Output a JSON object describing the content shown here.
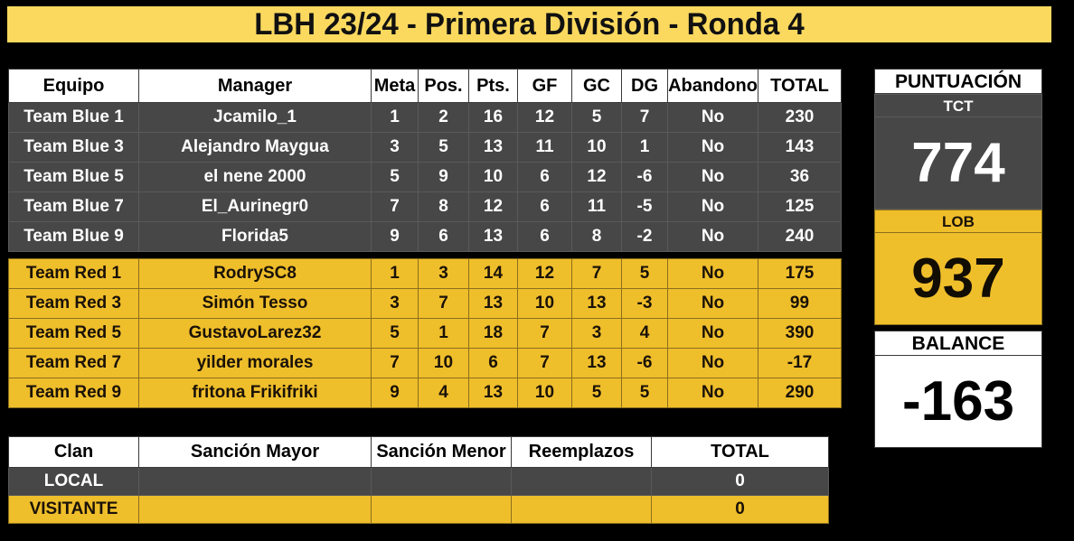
{
  "header": {
    "title": "LBH 23/24 - Primera División - Ronda 4",
    "banner_color": "#FBD95F"
  },
  "colors": {
    "yellow": "#EFBE2B",
    "dark_gray": "#474747",
    "white": "#FFFFFF",
    "black": "#000000"
  },
  "standings": {
    "columns": [
      "Equipo",
      "Manager",
      "Meta",
      "Pos.",
      "Pts.",
      "GF",
      "GC",
      "DG",
      "Abandono",
      "TOTAL"
    ],
    "blue_rows": [
      {
        "equipo": "Team Blue 1",
        "manager": "Jcamilo_1",
        "meta": "1",
        "pos": "2",
        "pts": "16",
        "gf": "12",
        "gc": "5",
        "dg": "7",
        "abandono": "No",
        "total": "230"
      },
      {
        "equipo": "Team Blue 3",
        "manager": "Alejandro Maygua",
        "meta": "3",
        "pos": "5",
        "pts": "13",
        "gf": "11",
        "gc": "10",
        "dg": "1",
        "abandono": "No",
        "total": "143"
      },
      {
        "equipo": "Team Blue 5",
        "manager": "el nene 2000",
        "meta": "5",
        "pos": "9",
        "pts": "10",
        "gf": "6",
        "gc": "12",
        "dg": "-6",
        "abandono": "No",
        "total": "36"
      },
      {
        "equipo": "Team Blue 7",
        "manager": "El_Aurinegr0",
        "meta": "7",
        "pos": "8",
        "pts": "12",
        "gf": "6",
        "gc": "11",
        "dg": "-5",
        "abandono": "No",
        "total": "125"
      },
      {
        "equipo": "Team Blue 9",
        "manager": "Florida5",
        "meta": "9",
        "pos": "6",
        "pts": "13",
        "gf": "6",
        "gc": "8",
        "dg": "-2",
        "abandono": "No",
        "total": "240"
      }
    ],
    "red_rows": [
      {
        "equipo": "Team Red 1",
        "manager": "RodrySC8",
        "meta": "1",
        "pos": "3",
        "pts": "14",
        "gf": "12",
        "gc": "7",
        "dg": "5",
        "abandono": "No",
        "total": "175"
      },
      {
        "equipo": "Team Red 3",
        "manager": "Simón Tesso",
        "meta": "3",
        "pos": "7",
        "pts": "13",
        "gf": "10",
        "gc": "13",
        "dg": "-3",
        "abandono": "No",
        "total": "99"
      },
      {
        "equipo": "Team Red 5",
        "manager": "GustavoLarez32",
        "meta": "5",
        "pos": "1",
        "pts": "18",
        "gf": "7",
        "gc": "3",
        "dg": "4",
        "abandono": "No",
        "total": "390"
      },
      {
        "equipo": "Team Red 7",
        "manager": "yilder morales",
        "meta": "7",
        "pos": "10",
        "pts": "6",
        "gf": "7",
        "gc": "13",
        "dg": "-6",
        "abandono": "No",
        "total": "-17"
      },
      {
        "equipo": "Team Red 9",
        "manager": "fritona Frikifriki",
        "meta": "9",
        "pos": "4",
        "pts": "13",
        "gf": "10",
        "gc": "5",
        "dg": "5",
        "abandono": "No",
        "total": "290"
      }
    ]
  },
  "sanctions": {
    "columns": [
      "Clan",
      "Sanción Mayor",
      "Sanción Menor",
      "Reemplazos",
      "TOTAL"
    ],
    "rows": [
      {
        "clan": "LOCAL",
        "mayor": "",
        "menor": "",
        "reemplazos": "",
        "total": "0"
      },
      {
        "clan": "VISITANTE",
        "mayor": "",
        "menor": "",
        "reemplazos": "",
        "total": "0"
      }
    ]
  },
  "scoreboard": {
    "title": "PUNTUACIÓN",
    "tct_label": "TCT",
    "tct_value": "774",
    "lob_label": "LOB",
    "lob_value": "937",
    "balance_label": "BALANCE",
    "balance_value": "-163"
  }
}
